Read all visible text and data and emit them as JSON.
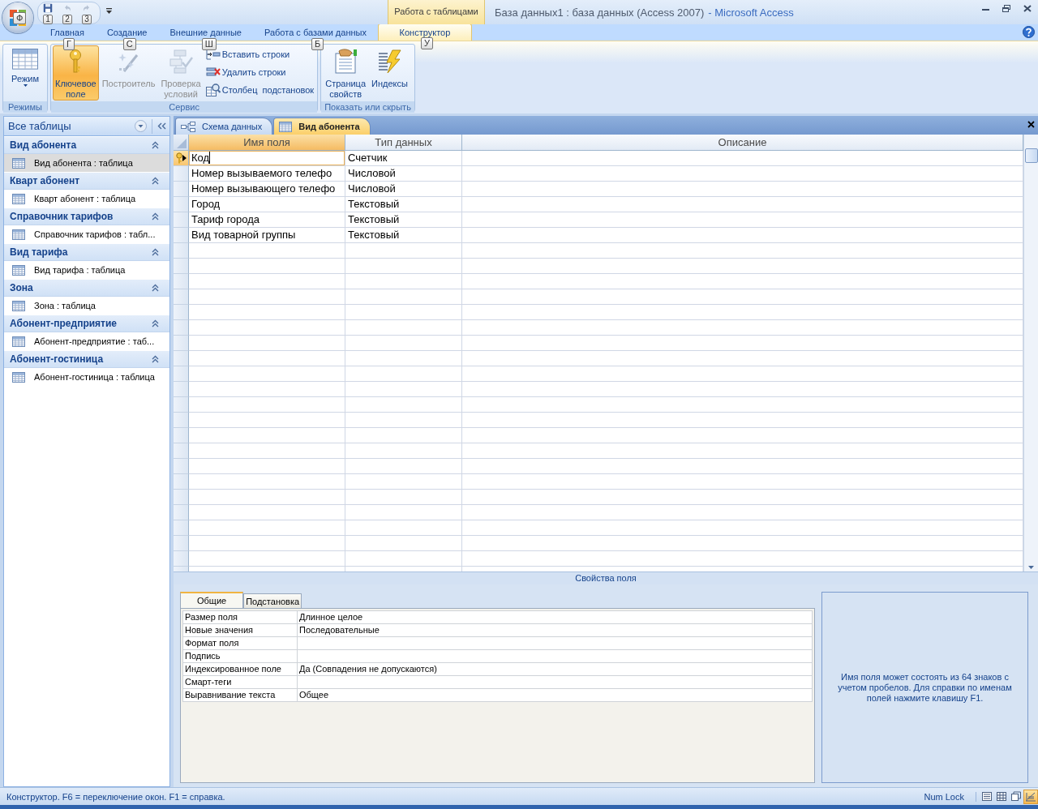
{
  "office_button": {
    "keytip": "Ф"
  },
  "quick_access": [
    {
      "kind": "save",
      "keytip": "1",
      "disabled": false
    },
    {
      "kind": "undo",
      "keytip": "2",
      "disabled": true
    },
    {
      "kind": "redo",
      "keytip": "3",
      "disabled": true
    }
  ],
  "contextual_group": "Работа с таблицами",
  "window": {
    "title": "База данных1 : база данных (Access 2007)",
    "app": "- Microsoft Access"
  },
  "ribbon_tabs": [
    {
      "label": "Главная",
      "keytip": "Г",
      "selected": false
    },
    {
      "label": "Создание",
      "keytip": "С",
      "selected": false
    },
    {
      "label": "Внешние данные",
      "keytip": "Ш",
      "selected": false
    },
    {
      "label": "Работа с базами данных",
      "keytip": "Б",
      "selected": false
    },
    {
      "label": "Конструктор",
      "keytip": "У",
      "selected": true
    }
  ],
  "ribbon_groups": [
    {
      "title": "Режимы",
      "buttons": [
        {
          "kind": "large",
          "label": "Режим",
          "dropdown": true,
          "selected": false,
          "disabled": false
        }
      ]
    },
    {
      "title": "Сервис",
      "buttons": [
        {
          "kind": "large",
          "label": "Ключевое\nполе",
          "selected": true,
          "disabled": false
        },
        {
          "kind": "large",
          "label": "Построитель",
          "selected": false,
          "disabled": true
        },
        {
          "kind": "large",
          "label": "Проверка\nусловий",
          "selected": false,
          "disabled": true
        },
        {
          "kind": "small",
          "label": "Вставить строки",
          "selected": false,
          "disabled": false
        },
        {
          "kind": "small",
          "label": "Удалить строки",
          "selected": false,
          "disabled": false
        },
        {
          "kind": "small",
          "label": "Столбец  подстановок",
          "selected": false,
          "disabled": false
        }
      ]
    },
    {
      "title": "Показать или скрыть",
      "buttons": [
        {
          "kind": "large",
          "label": "Страница\nсвойств",
          "selected": false,
          "disabled": false
        },
        {
          "kind": "large",
          "label": "Индексы",
          "selected": false,
          "disabled": false
        }
      ]
    }
  ],
  "navigation": {
    "header": "Все таблицы",
    "groups": [
      {
        "title": "Вид абонента",
        "expanded": true,
        "items": [
          {
            "label": "Вид абонента : таблица",
            "selected": true
          }
        ]
      },
      {
        "title": "Кварт абонент",
        "expanded": true,
        "items": [
          {
            "label": "Кварт абонент : таблица",
            "selected": false
          }
        ]
      },
      {
        "title": "Справочник тарифов",
        "expanded": true,
        "items": [
          {
            "label": "Справочник тарифов : табл...",
            "selected": false
          }
        ]
      },
      {
        "title": "Вид тарифа",
        "expanded": true,
        "items": [
          {
            "label": "Вид тарифа : таблица",
            "selected": false
          }
        ]
      },
      {
        "title": "Зона",
        "expanded": true,
        "items": [
          {
            "label": "Зона : таблица",
            "selected": false
          }
        ]
      },
      {
        "title": "Абонент-предприятие",
        "expanded": true,
        "items": [
          {
            "label": "Абонент-предприятие : таб...",
            "selected": false
          }
        ]
      },
      {
        "title": "Абонент-гостиница",
        "expanded": true,
        "items": [
          {
            "label": "Абонент-гостиница : таблица",
            "selected": false
          }
        ]
      }
    ]
  },
  "document_tabs": [
    {
      "kind": "diagram",
      "label": "Схема данных",
      "selected": false
    },
    {
      "kind": "table",
      "label": "Вид абонента",
      "selected": true
    }
  ],
  "design_grid": {
    "columns": [
      {
        "label": "Имя поля",
        "selected": true
      },
      {
        "label": "Тип данных",
        "selected": false
      },
      {
        "label": "Описание",
        "selected": false
      }
    ],
    "rows": [
      {
        "field_name": "Код",
        "data_type": "Счетчик",
        "primary_key": true,
        "current": true
      },
      {
        "field_name": "Номер вызываемого телефо",
        "data_type": "Числовой",
        "primary_key": false,
        "current": false
      },
      {
        "field_name": "Номер вызывающего телефо",
        "data_type": "Числовой",
        "primary_key": false,
        "current": false
      },
      {
        "field_name": "Город",
        "data_type": "Текстовый",
        "primary_key": false,
        "current": false
      },
      {
        "field_name": "Тариф города",
        "data_type": "Текстовый",
        "primary_key": false,
        "current": false
      },
      {
        "field_name": "Вид товарной группы",
        "data_type": "Текстовый",
        "primary_key": false,
        "current": false
      }
    ]
  },
  "field_properties": {
    "title": "Свойства поля",
    "tabs": [
      {
        "label": "Общие",
        "selected": true
      },
      {
        "label": "Подстановка",
        "selected": false
      }
    ],
    "rows": [
      {
        "label": "Размер поля",
        "value": "Длинное целое"
      },
      {
        "label": "Новые значения",
        "value": "Последовательные"
      },
      {
        "label": "Формат поля"
      },
      {
        "label": "Подпись"
      },
      {
        "label": "Индексированное поле",
        "value": "Да (Совпадения не допускаются)"
      },
      {
        "label": "Смарт-теги"
      },
      {
        "label": "Выравнивание текста",
        "value": "Общее"
      }
    ],
    "help": "Имя поля может состоять из 64 знаков с учетом пробелов.  Для справки по именам полей нажмите клавишу F1."
  },
  "status_bar": {
    "text": "Конструктор.  F6 = переключение окон.  F1 = справка.",
    "indicator": "Num Lock",
    "views": [
      {
        "selected": false
      },
      {
        "selected": false
      },
      {
        "selected": false
      },
      {
        "selected": true
      }
    ]
  }
}
